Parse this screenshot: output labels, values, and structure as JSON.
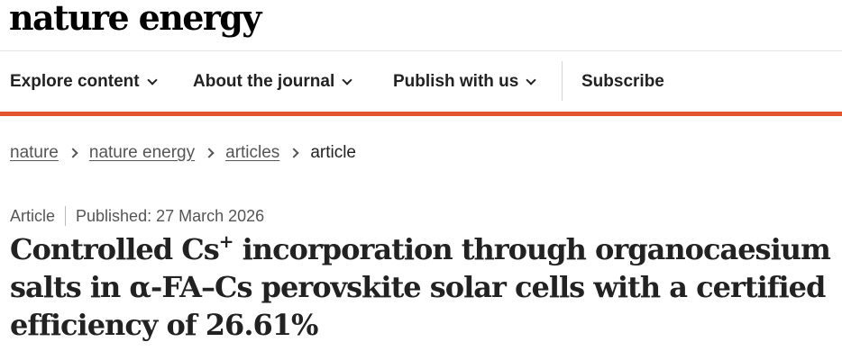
{
  "site": {
    "logo_text": "nature energy"
  },
  "nav": {
    "items": [
      {
        "label": "Explore content",
        "has_dropdown": true
      },
      {
        "label": "About the journal",
        "has_dropdown": true
      },
      {
        "label": "Publish with us",
        "has_dropdown": true
      },
      {
        "label": "Subscribe",
        "has_dropdown": false
      }
    ]
  },
  "colors": {
    "accent": "#e1542e",
    "text": "#222222",
    "muted": "#555555"
  },
  "breadcrumb": {
    "items": [
      "nature",
      "nature energy",
      "articles",
      "article"
    ]
  },
  "article": {
    "type": "Article",
    "published": "Published: 27 March 2026",
    "title_parts": {
      "line1_a": "Controlled Cs",
      "line1_sup": "+",
      "line1_b": " incorporation through organocaesium",
      "line2": "salts in α-FA–Cs perovskite solar cells with a certified",
      "line3": "efficiency of 26.61%"
    }
  }
}
